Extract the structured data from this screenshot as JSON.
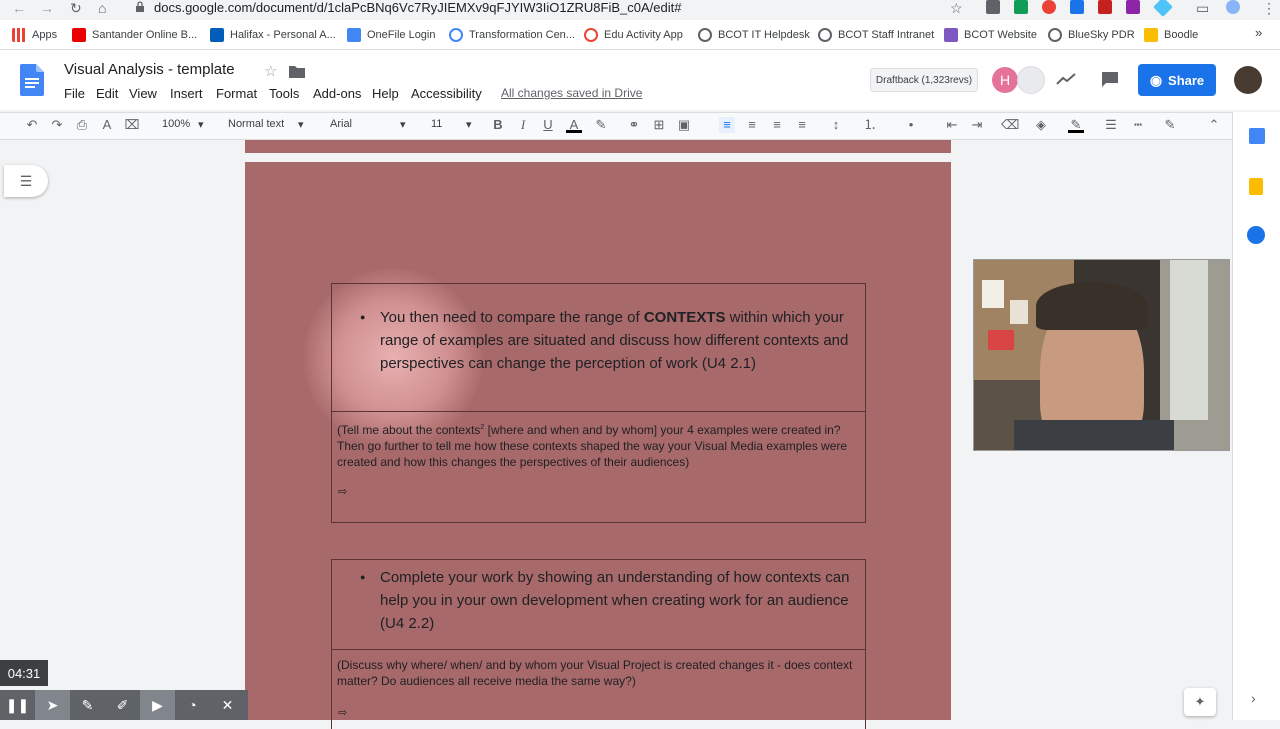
{
  "browser": {
    "url": "docs.google.com/document/d/1claPcBNq6Vc7RyJIEMXv9qFJYIW3IiO1ZRU8FiB_c0A/edit#",
    "bookmarks": [
      "Apps",
      "Santander Online B...",
      "Halifax - Personal A...",
      "OneFile Login",
      "Transformation Cen...",
      "Edu Activity App",
      "BCOT IT Helpdesk",
      "BCOT Staff Intranet",
      "BCOT Website",
      "BlueSky PDR",
      "Boodle"
    ],
    "bookmark_colors": [
      "#ea4335",
      "#c5221f",
      "#1a73e8",
      "#4285f4",
      "#4285f4",
      "#ea4335",
      "#5f6368",
      "#5f6368",
      "#7e57c2",
      "#5f6368",
      "#fbbc04"
    ]
  },
  "docs": {
    "title": "Visual Analysis - template",
    "menu": [
      "File",
      "Edit",
      "View",
      "Insert",
      "Format",
      "Tools",
      "Add-ons",
      "Help",
      "Accessibility"
    ],
    "saved": "All changes saved in Drive",
    "draftback": "Draftback (1,323revs)",
    "share": "Share",
    "avatar_letter": "H"
  },
  "toolbar": {
    "zoom": "100%",
    "style": "Normal text",
    "font": "Arial",
    "size": "11"
  },
  "content": {
    "box1": {
      "bullet_pre": "You then need to compare the range of ",
      "bullet_bold": "CONTEXTS",
      "bullet_post": " within which your range of examples are situated and discuss how different contexts and perspectives can change the perception of work (U4 2.1)",
      "hint_pre": "(Tell me about the contexts",
      "hint_sup": "2",
      "hint_post": " [where and when and by whom] your 4 examples were created in? Then go further to tell me how these contexts shaped the way your Visual Media examples were created and how this changes the perspectives of their audiences)",
      "arrow": "⇨"
    },
    "box2": {
      "bullet": "Complete your work by showing an understanding of how contexts can help you in your own development when creating work for an audience (U4 2.2)",
      "hint": "(Discuss why where/ when/ and by whom your Visual Project is created changes it - does context matter? Do audiences all receive media the same way?)",
      "arrow": "⇨"
    }
  },
  "recording": {
    "time": "04:31"
  }
}
